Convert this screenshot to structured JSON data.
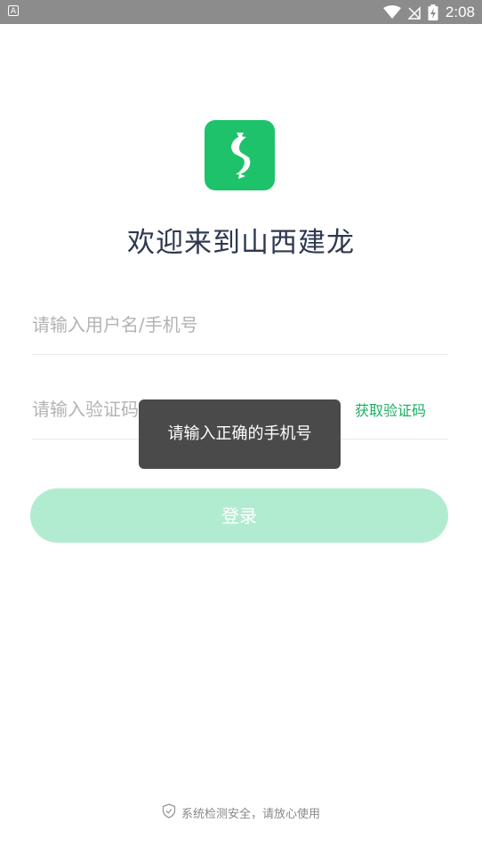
{
  "status_bar": {
    "app_indicator": "A",
    "time": "2:08",
    "icons": [
      "wifi-icon",
      "no-signal-icon",
      "battery-charging-icon"
    ]
  },
  "app": {
    "logo_icon": "app-logo-icon",
    "brand_color": "#1ec26a",
    "welcome_text": "欢迎来到山西建龙"
  },
  "form": {
    "username_placeholder": "请输入用户名/手机号",
    "username_value": "",
    "code_placeholder": "请输入验证码",
    "code_value": "",
    "get_code_label": "获取验证码",
    "login_label": "登录"
  },
  "toast": {
    "message": "请输入正确的手机号"
  },
  "footer": {
    "security_icon": "shield-check-icon",
    "security_text": "系统检测安全，请放心使用"
  }
}
